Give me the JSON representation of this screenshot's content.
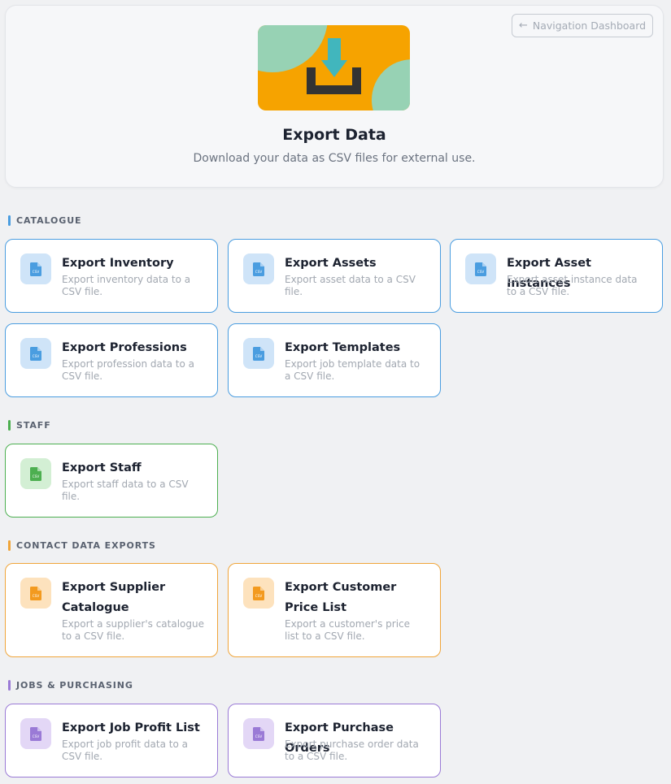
{
  "header": {
    "nav_button_label": "Navigation Dashboard",
    "title": "Export Data",
    "subtitle": "Download your data as CSV files for external use."
  },
  "colors": {
    "catalogue": "#4a9de0",
    "staff": "#4caf50",
    "contact": "#f0a53a",
    "jobs": "#9a7ad6",
    "illustration_bg": "#f6a300",
    "illustration_accent": "#97d2b4"
  },
  "file_icon_text": "CSV",
  "sections": [
    {
      "label": "CATALOGUE",
      "cards": [
        {
          "title": "Export Inventory",
          "description": "Export inventory data to a CSV file.",
          "icon": "csv-file-icon"
        },
        {
          "title": "Export Assets",
          "description": "Export asset data to a CSV file.",
          "icon": "csv-file-icon"
        },
        {
          "title": "Export Asset Instances",
          "description": "Export asset instance data to a CSV file.",
          "icon": "csv-file-icon"
        },
        {
          "title": "Export Professions",
          "description": "Export profession data to a CSV file.",
          "icon": "csv-file-icon"
        },
        {
          "title": "Export Templates",
          "description": "Export job template data to a CSV file.",
          "icon": "csv-file-icon"
        }
      ]
    },
    {
      "label": "STAFF",
      "cards": [
        {
          "title": "Export Staff",
          "description": "Export staff data to a CSV file.",
          "icon": "csv-file-icon"
        }
      ]
    },
    {
      "label": "CONTACT DATA EXPORTS",
      "cards": [
        {
          "title": "Export Supplier Catalogue",
          "description": "Export a supplier's catalogue to a CSV file.",
          "icon": "csv-file-icon"
        },
        {
          "title": "Export Customer Price List",
          "description": "Export a customer's price list to a CSV file.",
          "icon": "csv-file-icon"
        }
      ]
    },
    {
      "label": "JOBS & PURCHASING",
      "cards": [
        {
          "title": "Export Job Profit List",
          "description": "Export job profit data to a CSV file.",
          "icon": "csv-file-icon"
        },
        {
          "title": "Export Purchase Orders",
          "description": "Export purchase order data to a CSV file.",
          "icon": "csv-file-icon"
        }
      ]
    }
  ]
}
